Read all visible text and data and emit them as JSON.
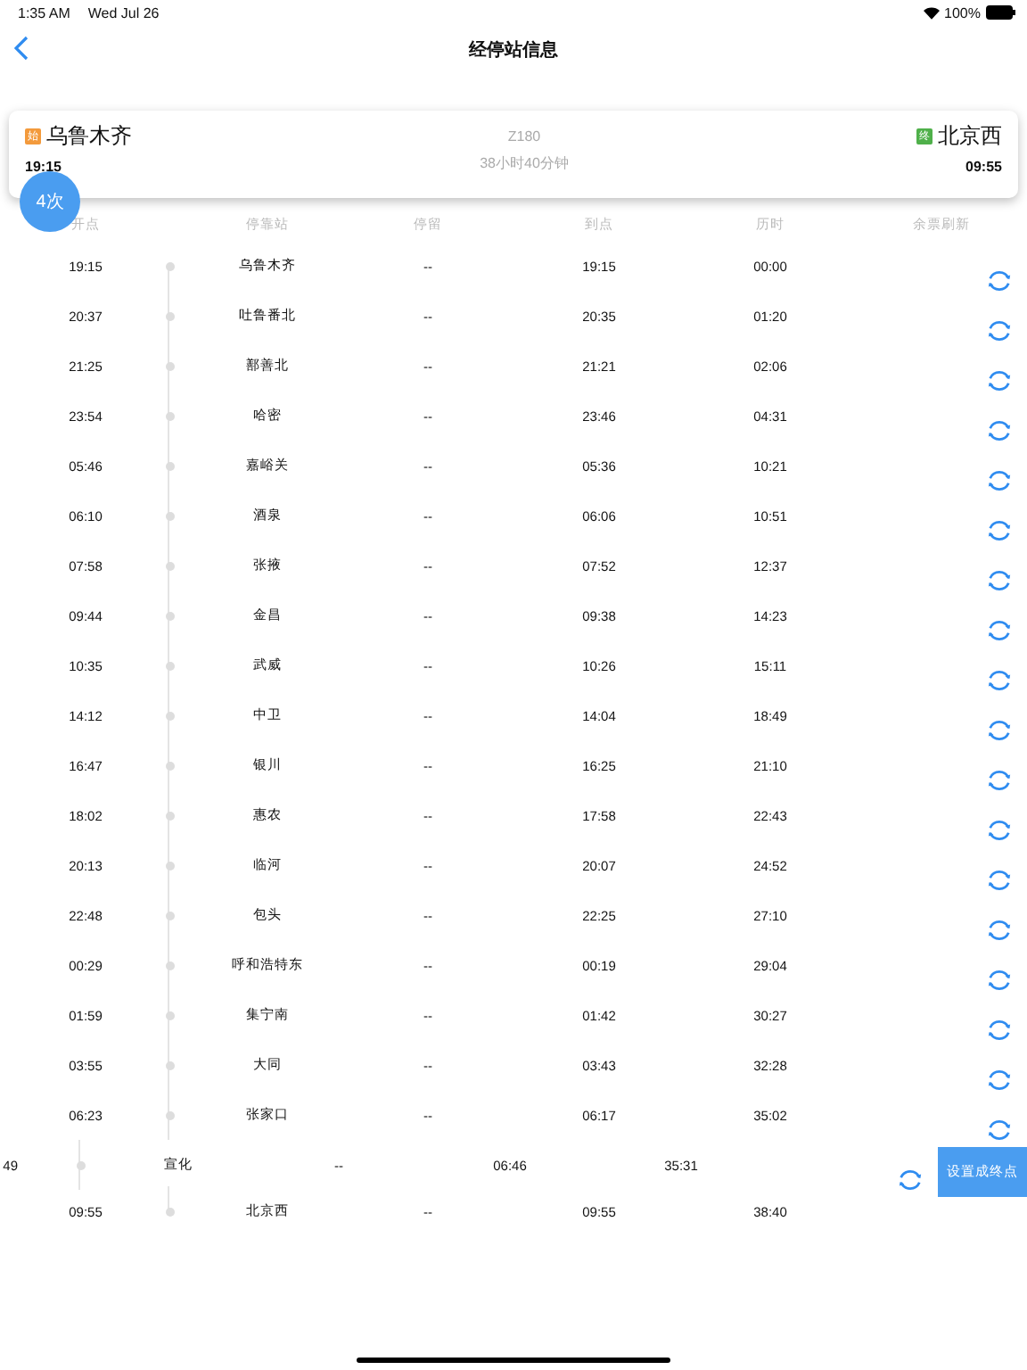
{
  "status_bar": {
    "time": "1:35 AM",
    "date": "Wed Jul 26",
    "battery": "100%"
  },
  "nav": {
    "title": "经停站信息"
  },
  "summary": {
    "from_tag": "始",
    "from": "乌鲁木齐",
    "depart": "19:15",
    "train": "Z180",
    "duration": "38小时40分钟",
    "to_tag": "终",
    "to": "北京西",
    "arrive": "09:55",
    "count_badge": "4次"
  },
  "table": {
    "columns": [
      "开点",
      "停靠站",
      "停留",
      "到点",
      "历时",
      "余票刷新"
    ],
    "rows": [
      {
        "depart": "19:15",
        "station": "乌鲁木齐",
        "stop": "--",
        "arrive": "19:15",
        "elapsed": "00:00",
        "refresh": true,
        "swiped": false
      },
      {
        "depart": "20:37",
        "station": "吐鲁番北",
        "stop": "--",
        "arrive": "20:35",
        "elapsed": "01:20",
        "refresh": true,
        "swiped": false
      },
      {
        "depart": "21:25",
        "station": "鄯善北",
        "stop": "--",
        "arrive": "21:21",
        "elapsed": "02:06",
        "refresh": true,
        "swiped": false
      },
      {
        "depart": "23:54",
        "station": "哈密",
        "stop": "--",
        "arrive": "23:46",
        "elapsed": "04:31",
        "refresh": true,
        "swiped": false
      },
      {
        "depart": "05:46",
        "station": "嘉峪关",
        "stop": "--",
        "arrive": "05:36",
        "elapsed": "10:21",
        "refresh": true,
        "swiped": false
      },
      {
        "depart": "06:10",
        "station": "酒泉",
        "stop": "--",
        "arrive": "06:06",
        "elapsed": "10:51",
        "refresh": true,
        "swiped": false
      },
      {
        "depart": "07:58",
        "station": "张掖",
        "stop": "--",
        "arrive": "07:52",
        "elapsed": "12:37",
        "refresh": true,
        "swiped": false
      },
      {
        "depart": "09:44",
        "station": "金昌",
        "stop": "--",
        "arrive": "09:38",
        "elapsed": "14:23",
        "refresh": true,
        "swiped": false
      },
      {
        "depart": "10:35",
        "station": "武威",
        "stop": "--",
        "arrive": "10:26",
        "elapsed": "15:11",
        "refresh": true,
        "swiped": false
      },
      {
        "depart": "14:12",
        "station": "中卫",
        "stop": "--",
        "arrive": "14:04",
        "elapsed": "18:49",
        "refresh": true,
        "swiped": false
      },
      {
        "depart": "16:47",
        "station": "银川",
        "stop": "--",
        "arrive": "16:25",
        "elapsed": "21:10",
        "refresh": true,
        "swiped": false
      },
      {
        "depart": "18:02",
        "station": "惠农",
        "stop": "--",
        "arrive": "17:58",
        "elapsed": "22:43",
        "refresh": true,
        "swiped": false
      },
      {
        "depart": "20:13",
        "station": "临河",
        "stop": "--",
        "arrive": "20:07",
        "elapsed": "24:52",
        "refresh": true,
        "swiped": false
      },
      {
        "depart": "22:48",
        "station": "包头",
        "stop": "--",
        "arrive": "22:25",
        "elapsed": "27:10",
        "refresh": true,
        "swiped": false
      },
      {
        "depart": "00:29",
        "station": "呼和浩特东",
        "stop": "--",
        "arrive": "00:19",
        "elapsed": "29:04",
        "refresh": true,
        "swiped": false
      },
      {
        "depart": "01:59",
        "station": "集宁南",
        "stop": "--",
        "arrive": "01:42",
        "elapsed": "30:27",
        "refresh": true,
        "swiped": false
      },
      {
        "depart": "03:55",
        "station": "大同",
        "stop": "--",
        "arrive": "03:43",
        "elapsed": "32:28",
        "refresh": true,
        "swiped": false
      },
      {
        "depart": "06:23",
        "station": "张家口",
        "stop": "--",
        "arrive": "06:17",
        "elapsed": "35:02",
        "refresh": true,
        "swiped": false
      },
      {
        "depart": "49",
        "station": "宣化",
        "stop": "--",
        "arrive": "06:46",
        "elapsed": "35:31",
        "refresh": true,
        "swiped": true,
        "action": "设置成终点"
      },
      {
        "depart": "09:55",
        "station": "北京西",
        "stop": "--",
        "arrive": "09:55",
        "elapsed": "38:40",
        "refresh": false,
        "swiped": false
      }
    ]
  }
}
